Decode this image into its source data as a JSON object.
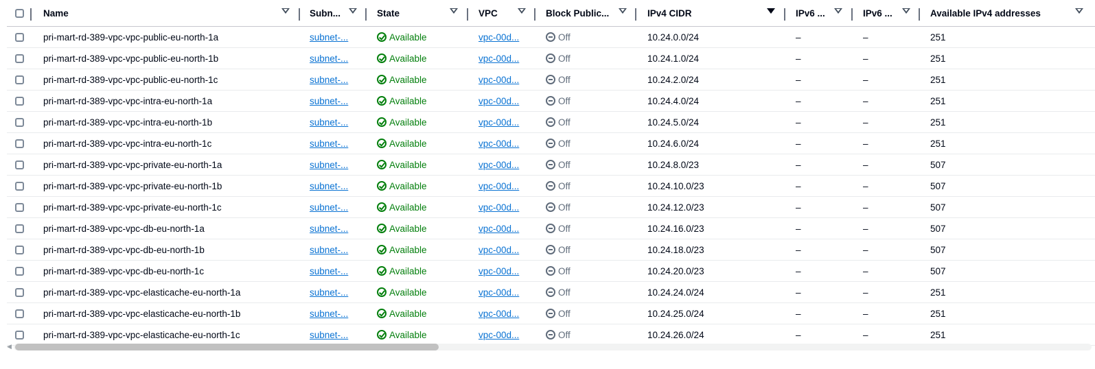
{
  "columns": {
    "name": "Name",
    "subnet": "Subn...",
    "state": "State",
    "vpc": "VPC",
    "block_public": "Block Public...",
    "ipv4_cidr": "IPv4 CIDR",
    "ipv6_a": "IPv6 ...",
    "ipv6_b": "IPv6 ...",
    "available_ipv4": "Available IPv4 addresses"
  },
  "colors": {
    "available": "#037f0c",
    "link": "#0972d3",
    "off": "#5f6b7a"
  },
  "rows": [
    {
      "name": "pri-mart-rd-389-vpc-vpc-public-eu-north-1a",
      "subnet": "subnet-...",
      "state": "Available",
      "vpc": "vpc-00d...",
      "block": "Off",
      "cidr": "10.24.0.0/24",
      "ipv6a": "–",
      "ipv6b": "–",
      "avail": "251"
    },
    {
      "name": "pri-mart-rd-389-vpc-vpc-public-eu-north-1b",
      "subnet": "subnet-...",
      "state": "Available",
      "vpc": "vpc-00d...",
      "block": "Off",
      "cidr": "10.24.1.0/24",
      "ipv6a": "–",
      "ipv6b": "–",
      "avail": "251"
    },
    {
      "name": "pri-mart-rd-389-vpc-vpc-public-eu-north-1c",
      "subnet": "subnet-...",
      "state": "Available",
      "vpc": "vpc-00d...",
      "block": "Off",
      "cidr": "10.24.2.0/24",
      "ipv6a": "–",
      "ipv6b": "–",
      "avail": "251"
    },
    {
      "name": "pri-mart-rd-389-vpc-vpc-intra-eu-north-1a",
      "subnet": "subnet-...",
      "state": "Available",
      "vpc": "vpc-00d...",
      "block": "Off",
      "cidr": "10.24.4.0/24",
      "ipv6a": "–",
      "ipv6b": "–",
      "avail": "251"
    },
    {
      "name": "pri-mart-rd-389-vpc-vpc-intra-eu-north-1b",
      "subnet": "subnet-...",
      "state": "Available",
      "vpc": "vpc-00d...",
      "block": "Off",
      "cidr": "10.24.5.0/24",
      "ipv6a": "–",
      "ipv6b": "–",
      "avail": "251"
    },
    {
      "name": "pri-mart-rd-389-vpc-vpc-intra-eu-north-1c",
      "subnet": "subnet-...",
      "state": "Available",
      "vpc": "vpc-00d...",
      "block": "Off",
      "cidr": "10.24.6.0/24",
      "ipv6a": "–",
      "ipv6b": "–",
      "avail": "251"
    },
    {
      "name": "pri-mart-rd-389-vpc-vpc-private-eu-north-1a",
      "subnet": "subnet-...",
      "state": "Available",
      "vpc": "vpc-00d...",
      "block": "Off",
      "cidr": "10.24.8.0/23",
      "ipv6a": "–",
      "ipv6b": "–",
      "avail": "507"
    },
    {
      "name": "pri-mart-rd-389-vpc-vpc-private-eu-north-1b",
      "subnet": "subnet-...",
      "state": "Available",
      "vpc": "vpc-00d...",
      "block": "Off",
      "cidr": "10.24.10.0/23",
      "ipv6a": "–",
      "ipv6b": "–",
      "avail": "507"
    },
    {
      "name": "pri-mart-rd-389-vpc-vpc-private-eu-north-1c",
      "subnet": "subnet-...",
      "state": "Available",
      "vpc": "vpc-00d...",
      "block": "Off",
      "cidr": "10.24.12.0/23",
      "ipv6a": "–",
      "ipv6b": "–",
      "avail": "507"
    },
    {
      "name": "pri-mart-rd-389-vpc-vpc-db-eu-north-1a",
      "subnet": "subnet-...",
      "state": "Available",
      "vpc": "vpc-00d...",
      "block": "Off",
      "cidr": "10.24.16.0/23",
      "ipv6a": "–",
      "ipv6b": "–",
      "avail": "507"
    },
    {
      "name": "pri-mart-rd-389-vpc-vpc-db-eu-north-1b",
      "subnet": "subnet-...",
      "state": "Available",
      "vpc": "vpc-00d...",
      "block": "Off",
      "cidr": "10.24.18.0/23",
      "ipv6a": "–",
      "ipv6b": "–",
      "avail": "507"
    },
    {
      "name": "pri-mart-rd-389-vpc-vpc-db-eu-north-1c",
      "subnet": "subnet-...",
      "state": "Available",
      "vpc": "vpc-00d...",
      "block": "Off",
      "cidr": "10.24.20.0/23",
      "ipv6a": "–",
      "ipv6b": "–",
      "avail": "507"
    },
    {
      "name": "pri-mart-rd-389-vpc-vpc-elasticache-eu-north-1a",
      "subnet": "subnet-...",
      "state": "Available",
      "vpc": "vpc-00d...",
      "block": "Off",
      "cidr": "10.24.24.0/24",
      "ipv6a": "–",
      "ipv6b": "–",
      "avail": "251"
    },
    {
      "name": "pri-mart-rd-389-vpc-vpc-elasticache-eu-north-1b",
      "subnet": "subnet-...",
      "state": "Available",
      "vpc": "vpc-00d...",
      "block": "Off",
      "cidr": "10.24.25.0/24",
      "ipv6a": "–",
      "ipv6b": "–",
      "avail": "251"
    },
    {
      "name": "pri-mart-rd-389-vpc-vpc-elasticache-eu-north-1c",
      "subnet": "subnet-...",
      "state": "Available",
      "vpc": "vpc-00d...",
      "block": "Off",
      "cidr": "10.24.26.0/24",
      "ipv6a": "–",
      "ipv6b": "–",
      "avail": "251"
    }
  ]
}
